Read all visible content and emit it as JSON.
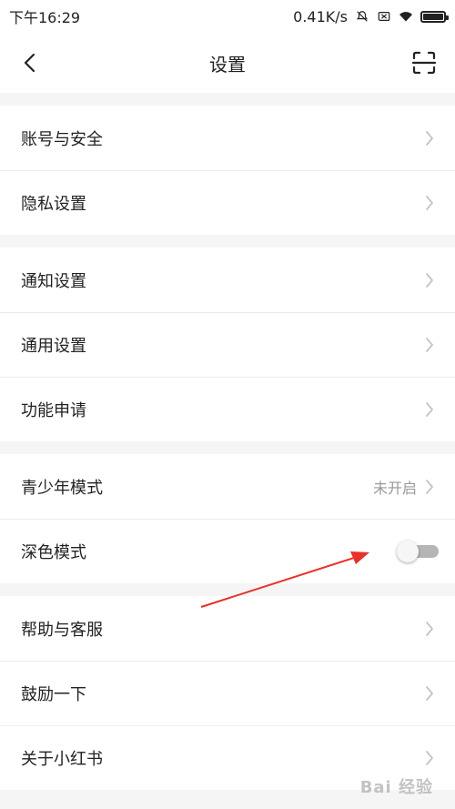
{
  "status_bar": {
    "time": "下午16:29",
    "net_speed": "0.41K/s",
    "icons": [
      "bell-muted-icon",
      "sim-off-icon",
      "wifi-icon",
      "battery-icon"
    ]
  },
  "nav": {
    "title": "设置",
    "back_icon": "chevron-left-icon",
    "scan_icon": "scan-icon"
  },
  "groups": [
    [
      {
        "label": "账号与安全"
      },
      {
        "label": "隐私设置"
      }
    ],
    [
      {
        "label": "通知设置"
      },
      {
        "label": "通用设置"
      },
      {
        "label": "功能申请"
      }
    ],
    [
      {
        "label": "青少年模式",
        "value": "未开启"
      },
      {
        "label": "深色模式",
        "toggle": false
      }
    ],
    [
      {
        "label": "帮助与客服"
      },
      {
        "label": "鼓励一下"
      },
      {
        "label": "关于小红书"
      }
    ]
  ],
  "watermark": "Bai 经验",
  "colors": {
    "arrow": "#e8312a",
    "chevron": "#c4c4c4",
    "toggle_track": "#b5b5b5"
  }
}
